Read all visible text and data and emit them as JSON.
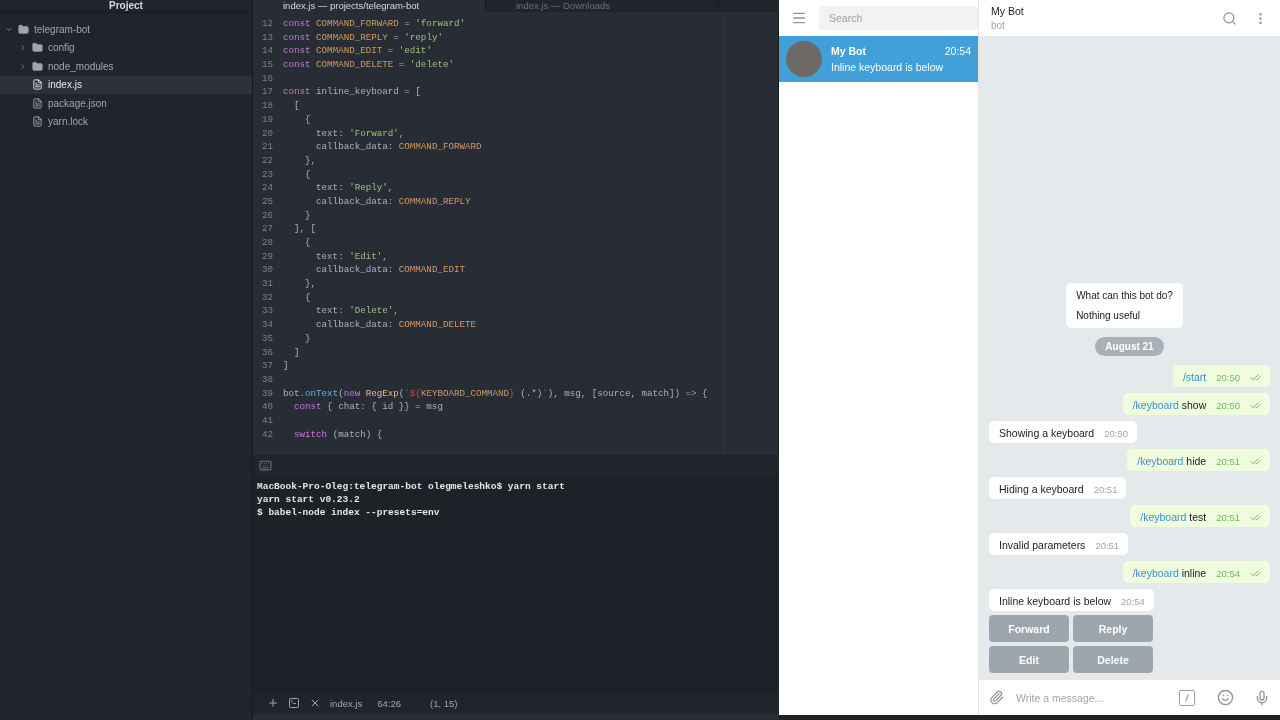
{
  "project": {
    "title": "Project",
    "tree": [
      {
        "kind": "folder",
        "name": "telegram-bot",
        "expanded": true,
        "selected": false,
        "children": [
          {
            "kind": "folder",
            "name": "config",
            "expanded": false,
            "selected": false
          },
          {
            "kind": "folder",
            "name": "node_modules",
            "expanded": false,
            "selected": false
          },
          {
            "kind": "file",
            "name": "index.js",
            "selected": true
          },
          {
            "kind": "file",
            "name": "package.json",
            "selected": false
          },
          {
            "kind": "file",
            "name": "yarn.lock",
            "selected": false
          }
        ]
      }
    ]
  },
  "editor": {
    "tabs": [
      {
        "label": "index.js — projects/telegram-bot",
        "selected": true
      },
      {
        "label": "index.js — Downloads",
        "selected": false
      }
    ],
    "lines": [
      {
        "number": "12",
        "tokens": [
          {
            "kind": "keyword",
            "text": "const "
          },
          {
            "kind": "constant",
            "text": "COMMAND_FORWARD"
          },
          {
            "kind": "plain",
            "text": " = "
          },
          {
            "kind": "string",
            "text": "'forward'"
          }
        ]
      },
      {
        "number": "13",
        "tokens": [
          {
            "kind": "keyword",
            "text": "const "
          },
          {
            "kind": "constant",
            "text": "COMMAND_REPLY"
          },
          {
            "kind": "plain",
            "text": " = "
          },
          {
            "kind": "string",
            "text": "'reply'"
          }
        ]
      },
      {
        "number": "14",
        "tokens": [
          {
            "kind": "keyword",
            "text": "const "
          },
          {
            "kind": "constant",
            "text": "COMMAND_EDIT"
          },
          {
            "kind": "plain",
            "text": " = "
          },
          {
            "kind": "string",
            "text": "'edit'"
          }
        ]
      },
      {
        "number": "15",
        "tokens": [
          {
            "kind": "keyword",
            "text": "const "
          },
          {
            "kind": "constant",
            "text": "COMMAND_DELETE"
          },
          {
            "kind": "plain",
            "text": " = "
          },
          {
            "kind": "string",
            "text": "'delete'"
          }
        ]
      },
      {
        "number": "16"
      },
      {
        "number": "17",
        "tokens": [
          {
            "kind": "keyword",
            "text": "const "
          },
          {
            "kind": "plain",
            "text": "inline_keyboard = ["
          }
        ]
      },
      {
        "number": "18",
        "tokens": [
          {
            "kind": "plain",
            "text": "  ["
          }
        ]
      },
      {
        "number": "19",
        "tokens": [
          {
            "kind": "plain",
            "text": "    {"
          }
        ]
      },
      {
        "number": "20",
        "tokens": [
          {
            "kind": "plain",
            "text": "      text: "
          },
          {
            "kind": "string",
            "text": "'Forward'"
          },
          {
            "kind": "plain",
            "text": ","
          }
        ]
      },
      {
        "number": "21",
        "tokens": [
          {
            "kind": "plain",
            "text": "      callback_data: "
          },
          {
            "kind": "constant",
            "text": "COMMAND_FORWARD"
          }
        ]
      },
      {
        "number": "22",
        "tokens": [
          {
            "kind": "plain",
            "text": "    },"
          }
        ]
      },
      {
        "number": "23",
        "tokens": [
          {
            "kind": "plain",
            "text": "    {"
          }
        ]
      },
      {
        "number": "24",
        "tokens": [
          {
            "kind": "plain",
            "text": "      text: "
          },
          {
            "kind": "string",
            "text": "'Reply'"
          },
          {
            "kind": "plain",
            "text": ","
          }
        ]
      },
      {
        "number": "25",
        "tokens": [
          {
            "kind": "plain",
            "text": "      callback_data: "
          },
          {
            "kind": "constant",
            "text": "COMMAND_REPLY"
          }
        ]
      },
      {
        "number": "26",
        "tokens": [
          {
            "kind": "plain",
            "text": "    }"
          }
        ]
      },
      {
        "number": "27",
        "tokens": [
          {
            "kind": "plain",
            "text": "  ], ["
          }
        ]
      },
      {
        "number": "28",
        "tokens": [
          {
            "kind": "plain",
            "text": "    {"
          }
        ]
      },
      {
        "number": "29",
        "tokens": [
          {
            "kind": "plain",
            "text": "      text: "
          },
          {
            "kind": "string",
            "text": "'Edit'"
          },
          {
            "kind": "plain",
            "text": ","
          }
        ]
      },
      {
        "number": "30",
        "tokens": [
          {
            "kind": "plain",
            "text": "      callback_data: "
          },
          {
            "kind": "constant",
            "text": "COMMAND_EDIT"
          }
        ]
      },
      {
        "number": "31",
        "tokens": [
          {
            "kind": "plain",
            "text": "    },"
          }
        ]
      },
      {
        "number": "32",
        "tokens": [
          {
            "kind": "plain",
            "text": "    {"
          }
        ]
      },
      {
        "number": "33",
        "tokens": [
          {
            "kind": "plain",
            "text": "      text: "
          },
          {
            "kind": "string",
            "text": "'Delete'"
          },
          {
            "kind": "plain",
            "text": ","
          }
        ]
      },
      {
        "number": "34",
        "tokens": [
          {
            "kind": "plain",
            "text": "      callback_data: "
          },
          {
            "kind": "constant",
            "text": "COMMAND_DELETE"
          }
        ]
      },
      {
        "number": "35",
        "tokens": [
          {
            "kind": "plain",
            "text": "    }"
          }
        ]
      },
      {
        "number": "36",
        "tokens": [
          {
            "kind": "plain",
            "text": "  ]"
          }
        ]
      },
      {
        "number": "37",
        "tokens": [
          {
            "kind": "plain",
            "text": "]"
          }
        ]
      },
      {
        "number": "38"
      },
      {
        "number": "39",
        "tokens": [
          {
            "kind": "plain",
            "text": "bot."
          },
          {
            "kind": "function",
            "text": "onText"
          },
          {
            "kind": "plain",
            "text": "("
          },
          {
            "kind": "keyword",
            "text": "new "
          },
          {
            "kind": "class",
            "text": "RegExp"
          },
          {
            "kind": "plain",
            "text": "(`"
          },
          {
            "kind": "punct",
            "text": "${"
          },
          {
            "kind": "constant",
            "text": "KEYBOARD_COMMAND"
          },
          {
            "kind": "punct",
            "text": "}"
          },
          {
            "kind": "plain",
            "text": " (.*)`), msg, [source, match]) "
          },
          {
            "kind": "keyword",
            "text": "=>"
          },
          {
            "kind": "plain",
            "text": " {"
          }
        ]
      },
      {
        "number": "40",
        "tokens": [
          {
            "kind": "keyword",
            "text": "  const "
          },
          {
            "kind": "plain",
            "text": "{ chat: { id }} = msg"
          }
        ]
      },
      {
        "number": "41"
      },
      {
        "number": "42",
        "tokens": [
          {
            "kind": "keyword",
            "text": "  switch "
          },
          {
            "kind": "plain",
            "text": "(match) {"
          }
        ]
      }
    ]
  },
  "terminal": {
    "lines": [
      "MacBook-Pro-Oleg:telegram-bot olegmeleshko$ yarn start",
      "yarn start v0.23.2",
      "$ babel-node index --presets=env"
    ]
  },
  "status_bar": {
    "file": "index.js",
    "position": "64:26",
    "selection": "(1, 15)"
  },
  "telegram": {
    "search": {
      "placeholder": "Search"
    },
    "chats": [
      {
        "name": "My Bot",
        "time": "20:54",
        "preview": "Inline keyboard is below",
        "selected": true
      }
    ],
    "header": {
      "title": "My Bot",
      "subtitle": "bot"
    },
    "bot_info": {
      "title": "What can this bot do?",
      "text": "Nothing useful"
    },
    "date": "August 21",
    "messages": [
      {
        "kind": "outgoing",
        "command": "/start",
        "time": "20:50"
      },
      {
        "kind": "outgoing",
        "command": "/keyboard",
        "text": "show",
        "time": "20:50"
      },
      {
        "kind": "incoming",
        "text": "Showing a keyboard",
        "time": "20:50"
      },
      {
        "kind": "outgoing",
        "command": "/keyboard",
        "text": "hide",
        "time": "20:51"
      },
      {
        "kind": "incoming",
        "text": "Hiding a keyboard",
        "time": "20:51"
      },
      {
        "kind": "outgoing",
        "command": "/keyboard",
        "text": "test",
        "time": "20:51"
      },
      {
        "kind": "incoming",
        "text": "Invalid parameters",
        "time": "20:51"
      },
      {
        "kind": "outgoing",
        "command": "/keyboard",
        "text": "inline",
        "time": "20:54"
      },
      {
        "kind": "incoming",
        "text": "Inline keyboard is below",
        "time": "20:54"
      }
    ],
    "keyboard": [
      [
        "Forward",
        "Reply"
      ],
      [
        "Edit",
        "Delete"
      ]
    ],
    "composer": {
      "placeholder": "Write a message..."
    }
  }
}
